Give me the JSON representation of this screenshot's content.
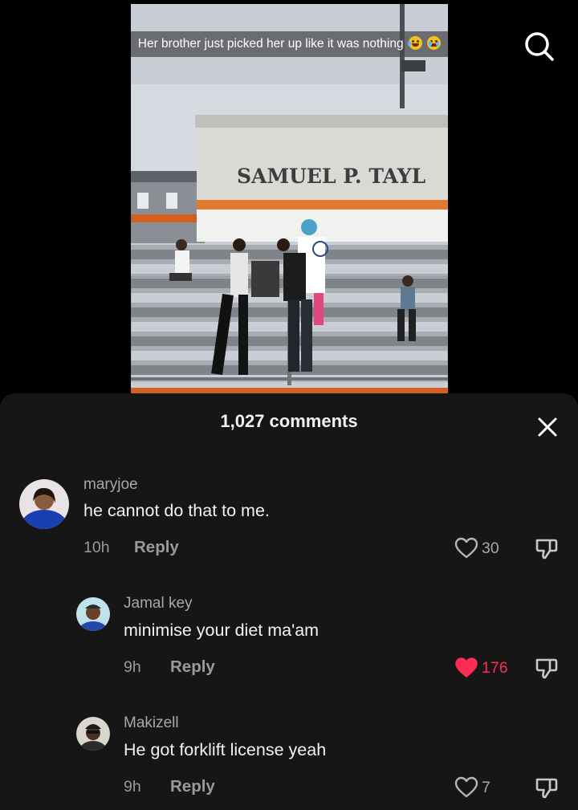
{
  "video": {
    "caption_text": "Her brother just picked her up like it was nothing",
    "caption_emojis": [
      "laughing-tears-emoji",
      "sobbing-emoji"
    ],
    "sign_text": "SAMUEL P. TAYL"
  },
  "header": {
    "search_icon": "search-icon"
  },
  "comments_sheet": {
    "title": "1,027 comments",
    "close_icon": "close-icon",
    "accent_like_color": "#fe2c55",
    "comments": [
      {
        "username": "maryjoe",
        "text": "he cannot do that to me.",
        "time": "10h",
        "reply_label": "Reply",
        "likes": "30",
        "liked": false
      },
      {
        "username": "Jamal key",
        "text": "minimise your diet ma'am",
        "time": "9h",
        "reply_label": "Reply",
        "likes": "176",
        "liked": true
      },
      {
        "username": "Makizell",
        "text": "He got forklift license yeah",
        "time": "9h",
        "reply_label": "Reply",
        "likes": "7",
        "liked": false
      }
    ]
  }
}
